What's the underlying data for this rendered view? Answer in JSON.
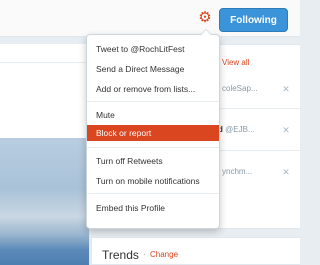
{
  "header": {
    "follow_button": "Following",
    "gear_icon": "gear-icon",
    "accent_color": "#d9461f",
    "button_color": "#3b94d9"
  },
  "who_to_follow": {
    "view_all": "View all",
    "suggestions": [
      {
        "text": "coleSap..."
      },
      {
        "name": "d",
        "text": "@EJB..."
      },
      {
        "text": "ynchm..."
      }
    ]
  },
  "dropdown_menu": {
    "items": [
      {
        "label": "Tweet to @RochLitFest"
      },
      {
        "label": "Send a Direct Message"
      },
      {
        "label": "Add or remove from lists..."
      },
      {
        "label": "Mute"
      },
      {
        "label": "Block or report"
      },
      {
        "label": "Turn off Retweets"
      },
      {
        "label": "Turn on mobile notifications"
      },
      {
        "label": "Embed this Profile"
      }
    ],
    "highlighted": "Block or report"
  },
  "trends": {
    "title": "Trends",
    "separator": "·",
    "change_label": "Change"
  }
}
